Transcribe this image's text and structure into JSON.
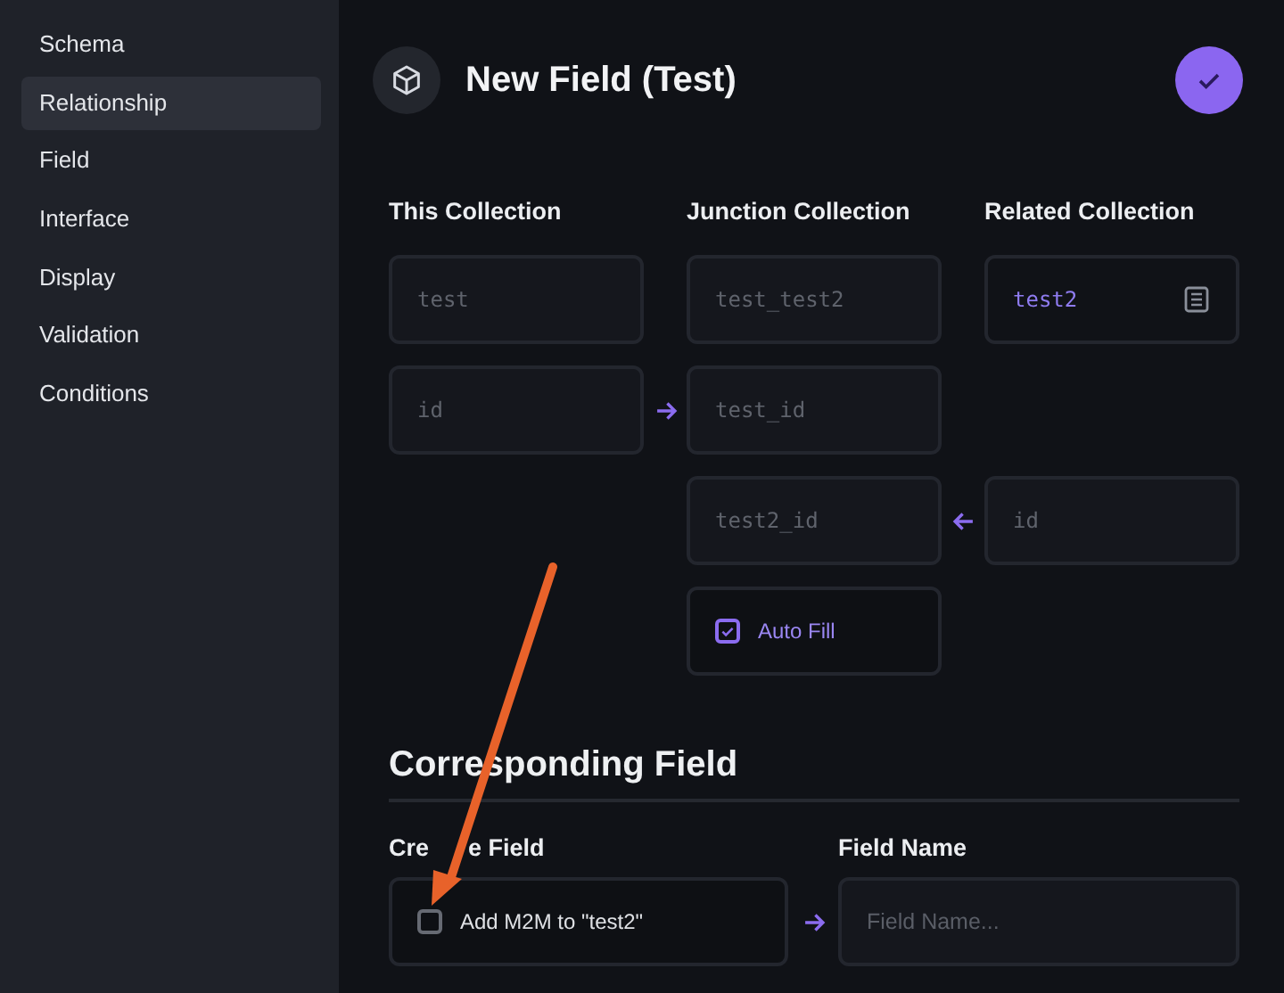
{
  "sidebar": {
    "items": [
      {
        "label": "Schema",
        "selected": false
      },
      {
        "label": "Relationship",
        "selected": true
      },
      {
        "label": "Field",
        "selected": false
      },
      {
        "label": "Interface",
        "selected": false
      },
      {
        "label": "Display",
        "selected": false
      },
      {
        "label": "Validation",
        "selected": false
      },
      {
        "label": "Conditions",
        "selected": false
      }
    ]
  },
  "header": {
    "title": "New Field (Test)"
  },
  "relation": {
    "columns": [
      "This Collection",
      "",
      "Junction Collection",
      "",
      "Related Collection"
    ],
    "rows": [
      {
        "cells": [
          {
            "kind": "input",
            "value": "test",
            "disabled": true
          },
          {
            "kind": "empty"
          },
          {
            "kind": "input",
            "value": "test_test2",
            "disabled": true
          },
          {
            "kind": "empty"
          },
          {
            "kind": "select",
            "value": "test2",
            "disabled": false
          }
        ]
      },
      {
        "cells": [
          {
            "kind": "input",
            "value": "id",
            "disabled": true
          },
          {
            "kind": "arrow_right"
          },
          {
            "kind": "input",
            "value": "test_id",
            "disabled": true
          },
          {
            "kind": "empty"
          },
          {
            "kind": "empty"
          }
        ]
      },
      {
        "cells": [
          {
            "kind": "empty"
          },
          {
            "kind": "empty"
          },
          {
            "kind": "input",
            "value": "test2_id",
            "disabled": true
          },
          {
            "kind": "arrow_left"
          },
          {
            "kind": "input",
            "value": "id",
            "disabled": true
          }
        ]
      },
      {
        "cells": [
          {
            "kind": "empty"
          },
          {
            "kind": "empty"
          },
          {
            "kind": "checkbox",
            "label": "Auto Fill",
            "checked": true
          },
          {
            "kind": "empty"
          },
          {
            "kind": "empty"
          }
        ]
      }
    ]
  },
  "corresponding": {
    "title": "Corresponding Field",
    "create": {
      "label_parts": [
        "Cre",
        "e Field"
      ],
      "option": "Add M2M to \"test2\"",
      "checked": false
    },
    "name": {
      "label": "Field Name",
      "placeholder": "Field Name..."
    }
  }
}
